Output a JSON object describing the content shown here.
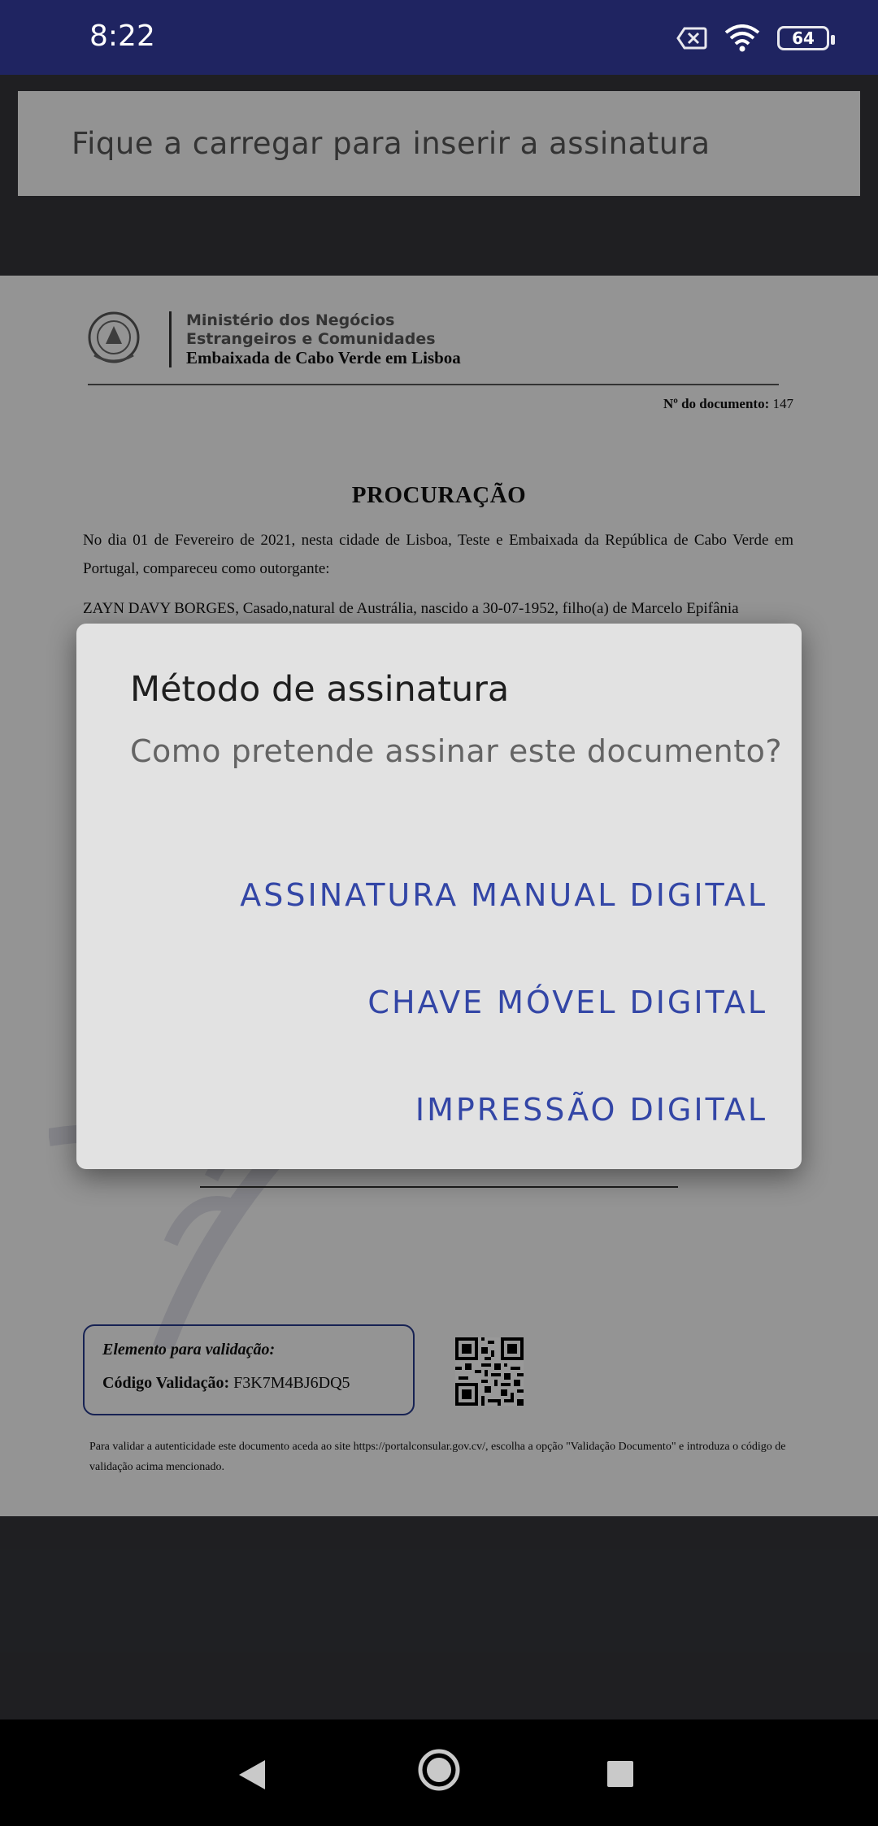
{
  "status_bar": {
    "time": "8:22",
    "battery": "64",
    "icons": [
      "no-sim-icon",
      "wifi-icon",
      "battery-icon"
    ]
  },
  "banner": {
    "text": "Fique a carregar para inserir a assinatura"
  },
  "document": {
    "ministry_line1": "Ministério dos Negócios",
    "ministry_line2": "Estrangeiros e Comunidades",
    "embassy": "Embaixada de Cabo Verde em Lisboa",
    "doc_number_label": "Nº do documento:",
    "doc_number": "147",
    "title": "PROCURAÇÃO",
    "para1": "No dia 01 de Fevereiro de 2021, nesta cidade de Lisboa, Teste e Embaixada da República de Cabo Verde em Portugal,  compareceu como outorgante:",
    "para2": "ZAYN DAVY BORGES, Casado,natural de Austrália, nascido a 30-07-1952, filho(a) de Marcelo Epifânia",
    "validation_title": "Elemento para validação:",
    "validation_label": "Código Validação:",
    "validation_code": "F3K7M4BJ6DQ5",
    "footer_note": "Para validar a autenticidade este documento aceda ao site https://portalconsular.gov.cv/, escolha a opção \"Validação Documento\" e introduza o código de validação acima mencionado."
  },
  "dialog": {
    "title": "Método de assinatura",
    "message": "Como pretende assinar este documento?",
    "options": [
      "ASSINATURA MANUAL DIGITAL",
      "CHAVE MÓVEL DIGITAL",
      "IMPRESSÃO DIGITAL"
    ],
    "accent_color": "#3346a6"
  },
  "nav_bar": {
    "icons": [
      "back-icon",
      "home-icon",
      "recents-icon"
    ]
  }
}
